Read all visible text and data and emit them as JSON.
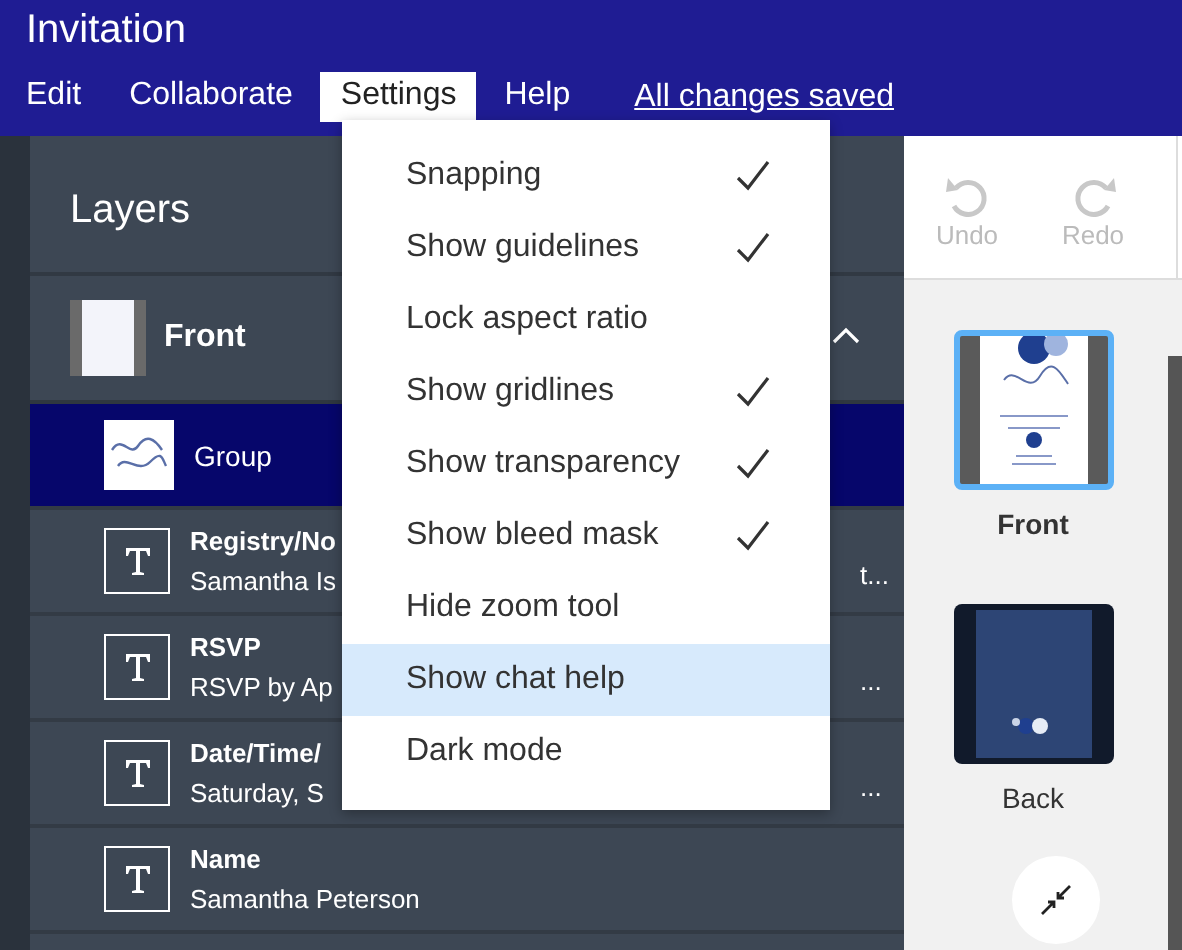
{
  "window": {
    "title": "Invitation"
  },
  "menubar": {
    "items": [
      {
        "label": "Edit",
        "selected": false
      },
      {
        "label": "Collaborate",
        "selected": false
      },
      {
        "label": "Settings",
        "selected": true
      },
      {
        "label": "Help",
        "selected": false
      }
    ],
    "status_link": "All changes saved"
  },
  "layers": {
    "title": "Layers",
    "page": {
      "label": "Front",
      "expanded": true
    },
    "items": [
      {
        "kind": "image",
        "title": "Group",
        "selected": true
      },
      {
        "kind": "text",
        "title": "Registry/No",
        "subtitle": "Samantha Is",
        "tail": "t...",
        "selected": false
      },
      {
        "kind": "text",
        "title": "RSVP",
        "subtitle": "RSVP by Ap",
        "tail": "...",
        "selected": false
      },
      {
        "kind": "text",
        "title": "Date/Time/",
        "subtitle": "Saturday, S",
        "tail": "...",
        "selected": false
      },
      {
        "kind": "text",
        "title": "Name",
        "subtitle": "Samantha Peterson",
        "selected": false
      }
    ]
  },
  "toolbar": {
    "buttons": [
      {
        "kind": "undo",
        "label": "Undo",
        "disabled": true
      },
      {
        "kind": "redo",
        "label": "Redo",
        "disabled": true
      }
    ]
  },
  "pages": [
    {
      "label": "Front",
      "kind": "front",
      "selected": true
    },
    {
      "label": "Back",
      "kind": "back",
      "selected": false
    }
  ],
  "settings_menu": {
    "items": [
      {
        "label": "Snapping",
        "checked": true,
        "highlighted": false
      },
      {
        "label": "Show guidelines",
        "checked": true,
        "highlighted": false
      },
      {
        "label": "Lock aspect ratio",
        "checked": false,
        "highlighted": false
      },
      {
        "label": "Show gridlines",
        "checked": true,
        "highlighted": false
      },
      {
        "label": "Show transparency",
        "checked": true,
        "highlighted": false
      },
      {
        "label": "Show bleed mask",
        "checked": true,
        "highlighted": false
      },
      {
        "label": "Hide zoom tool",
        "checked": false,
        "highlighted": false
      },
      {
        "label": "Show chat help",
        "checked": false,
        "highlighted": true
      },
      {
        "label": "Dark mode",
        "checked": false,
        "highlighted": false
      }
    ]
  }
}
